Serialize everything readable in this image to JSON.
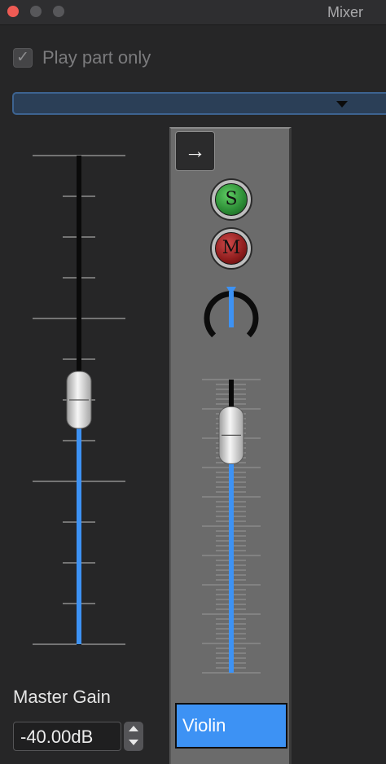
{
  "window": {
    "title": "Mixer",
    "controls": [
      "close",
      "minimize",
      "maximize"
    ]
  },
  "options": {
    "play_part_only_label": "Play part only",
    "play_part_only_checked": true,
    "check_glyph": "✓"
  },
  "dropdown": {
    "selected": ""
  },
  "master": {
    "label": "Master Gain",
    "gain_display": "-40.00dB",
    "fader_level": 0.5
  },
  "channel": {
    "route_icon": "→",
    "solo_label": "S",
    "mute_label": "M",
    "pan": 0.0,
    "fader_level": 0.81,
    "track_name": "Violin"
  },
  "colors": {
    "accent": "#3d92f4",
    "solo": "#2a8a34",
    "mute": "#8d1c1c",
    "close": "#ee5b54",
    "strip": "#6b6b6b"
  }
}
